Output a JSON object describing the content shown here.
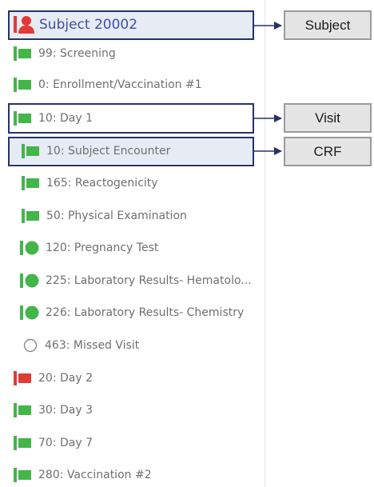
{
  "colors": {
    "complete_green": "#43b649",
    "alert_red": "#e53935",
    "frame_navy": "#25336b",
    "label_gray": "#6f6f6f",
    "subject_blue": "#3f51a3"
  },
  "tree": {
    "subject": {
      "label": "Subject 20002",
      "icon": "person-red-icon"
    },
    "items": [
      {
        "label": "99: Screening",
        "icon": "flag-icon",
        "status": "complete"
      },
      {
        "label": "0: Enrollment/Vaccination #1",
        "icon": "flag-icon",
        "status": "complete"
      },
      {
        "label": "10: Day 1",
        "icon": "flag-icon",
        "status": "complete"
      },
      {
        "label": "10: Subject Encounter",
        "icon": "flag-icon",
        "status": "complete"
      },
      {
        "label": "165: Reactogenicity",
        "icon": "flag-icon",
        "status": "complete"
      },
      {
        "label": "50: Physical Examination",
        "icon": "flag-icon",
        "status": "complete"
      },
      {
        "label": "120: Pregnancy Test",
        "icon": "circle-bar-icon",
        "status": "complete"
      },
      {
        "label": "225: Laboratory Results- Hematolo...",
        "icon": "circle-bar-icon",
        "status": "complete"
      },
      {
        "label": "226: Laboratory Results- Chemistry",
        "icon": "circle-bar-icon",
        "status": "complete"
      },
      {
        "label": "463: Missed Visit",
        "icon": "empty-circle-icon",
        "status": "not-started"
      },
      {
        "label": "20: Day 2",
        "icon": "flag-icon",
        "status": "alert"
      },
      {
        "label": "30: Day 3",
        "icon": "flag-icon",
        "status": "complete"
      },
      {
        "label": "70: Day 7",
        "icon": "flag-icon",
        "status": "complete"
      },
      {
        "label": "280: Vaccination #2",
        "icon": "flag-icon",
        "status": "complete"
      }
    ]
  },
  "callouts": {
    "subject": "Subject",
    "visit": "Visit",
    "crf": "CRF"
  }
}
